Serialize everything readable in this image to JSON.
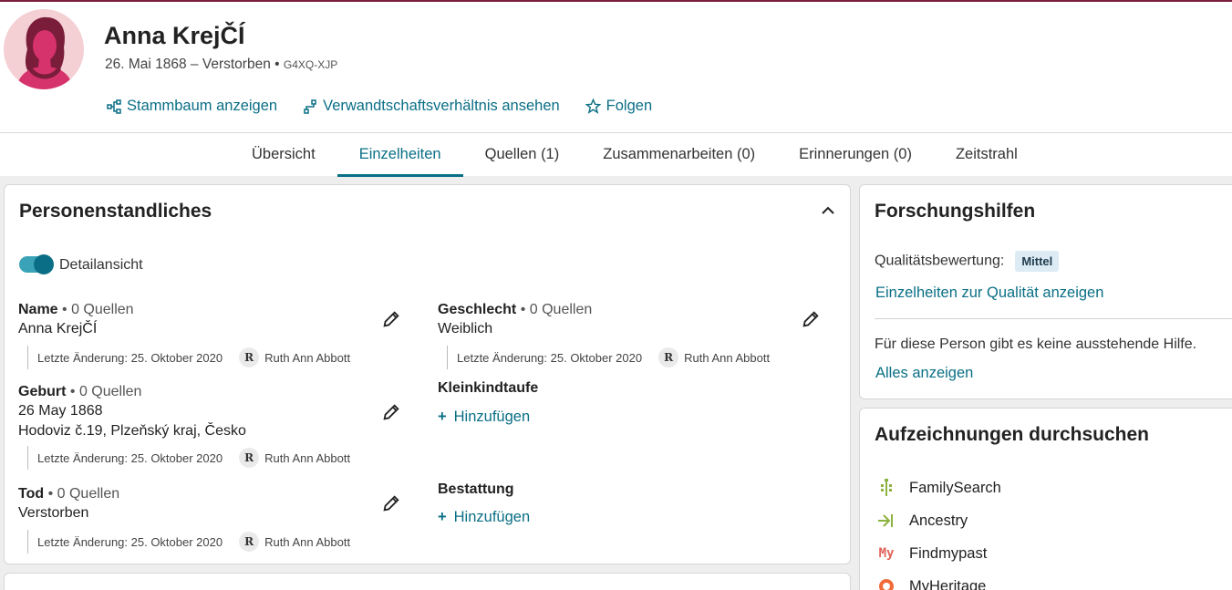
{
  "person": {
    "name": "Anna KrejČÍ",
    "lifespan": "26. Mai 1868 – Verstorben",
    "separator": "•",
    "id": "G4XQ-XJP"
  },
  "actions": {
    "tree": "Stammbaum anzeigen",
    "relationship": "Verwandtschaftsverhältnis ansehen",
    "follow": "Folgen"
  },
  "tabs": [
    "Übersicht",
    "Einzelheiten",
    "Quellen (1)",
    "Zusammenarbeiten (0)",
    "Erinnerungen (0)",
    "Zeitstrahl"
  ],
  "vitals": {
    "title": "Personenstandliches",
    "toggle_label": "Detailansicht",
    "name": {
      "label": "Name",
      "sources": "• 0 Quellen",
      "value": "Anna KrejČÍ",
      "changed": "Letzte Änderung: 25. Oktober 2020",
      "user_initial": "R",
      "user": "Ruth Ann Abbott"
    },
    "sex": {
      "label": "Geschlecht",
      "sources": "• 0 Quellen",
      "value": "Weiblich",
      "changed": "Letzte Änderung: 25. Oktober 2020",
      "user_initial": "R",
      "user": "Ruth Ann Abbott"
    },
    "birth": {
      "label": "Geburt",
      "sources": "• 0 Quellen",
      "date": "26 May 1868",
      "place": "Hodoviz č.19, Plzeňský kraj, Česko",
      "changed": "Letzte Änderung: 25. Oktober 2020",
      "user_initial": "R",
      "user": "Ruth Ann Abbott"
    },
    "death": {
      "label": "Tod",
      "sources": "• 0 Quellen",
      "value": "Verstorben",
      "changed": "Letzte Änderung: 25. Oktober 2020",
      "user_initial": "R",
      "user": "Ruth Ann Abbott"
    },
    "christening": {
      "label": "Kleinkindtaufe",
      "add": "Hinzufügen"
    },
    "burial": {
      "label": "Bestattung",
      "add": "Hinzufügen"
    },
    "plus": "+"
  },
  "research": {
    "title": "Forschungshilfen",
    "quality_label": "Qualitätsbewertung:",
    "quality_value": "Mittel",
    "quality_link": "Einzelheiten zur Qualität anzeigen",
    "no_help": "Für diese Person gibt es keine ausstehende Hilfe.",
    "show_all": "Alles anzeigen"
  },
  "records": {
    "title": "Aufzeichnungen durchsuchen",
    "items": [
      "FamilySearch",
      "Ancestry",
      "Findmypast",
      "MyHeritage"
    ],
    "findmypast_icon_text": "My"
  },
  "colors": {
    "accent": "#0a6f86",
    "top_line": "#7a1f3d",
    "quality_badge": "#dcebf4"
  }
}
